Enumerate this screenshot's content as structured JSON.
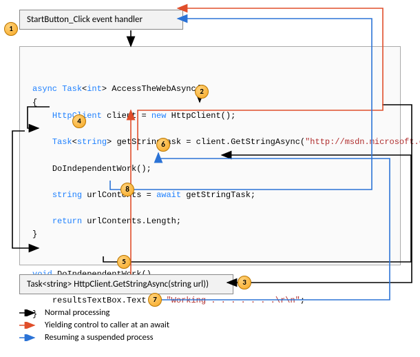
{
  "header": {
    "title": "StartButton_Click event handler"
  },
  "code": {
    "sig": {
      "kw": "async",
      "type": "Task",
      "generic": "int",
      "name": "AccessTheWebAsync"
    },
    "l_open": "{",
    "l1": {
      "indent": "    ",
      "type": "HttpClient",
      "var": " client = ",
      "kw": "new",
      "rest": " HttpClient();"
    },
    "l2": {
      "indent": "    ",
      "type": "Task",
      "generic": "string",
      "var": "> getStringTask = client.GetStringAsync(",
      "url": "\"http://msdn.microsoft.com\"",
      "end": ");"
    },
    "l3": {
      "indent": "    ",
      "text": "DoIndependentWork();"
    },
    "l4": {
      "indent": "    ",
      "type": "string",
      "var": " urlContents = ",
      "kw": "await",
      "rest": " getStringTask;"
    },
    "l5": {
      "indent": "    ",
      "kw": "return",
      "rest": " urlContents.Length;"
    },
    "l_close": "}",
    "sub_sig": {
      "kw": "void",
      "name": "DoIndependentWork"
    },
    "sub_open": "{",
    "sub1": {
      "indent": "    ",
      "text": "resultsTextBox.Text += ",
      "str": "\"Working . . . . . . .\\r\\n\"",
      "end": ";"
    },
    "sub_close": "}"
  },
  "footer": {
    "text": "Task<string> HttpClient.GetStringAsync(string url))"
  },
  "legend": {
    "l1": "Normal processing",
    "l2": "Yielding control to caller at an await",
    "l3": "Resuming a suspended process"
  },
  "badges": {
    "b1": "1",
    "b2": "2",
    "b3": "3",
    "b4": "4",
    "b5": "5",
    "b6": "6",
    "b7": "7",
    "b8": "8"
  }
}
